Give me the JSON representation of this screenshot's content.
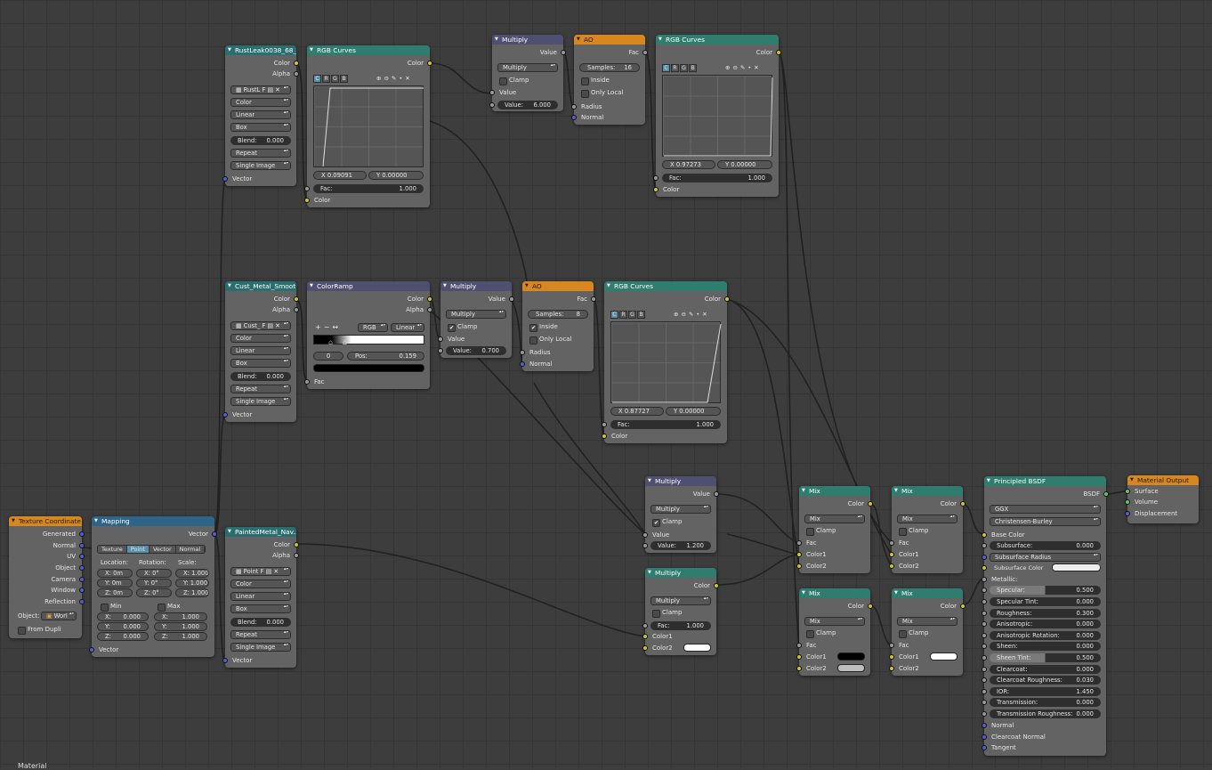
{
  "texcoord": {
    "title": "Texture Coordinate",
    "outputs": [
      "Generated",
      "Normal",
      "UV",
      "Object",
      "Camera",
      "Window",
      "Reflection"
    ],
    "object_label": "Object:",
    "object_value": "Worl",
    "from_dupli": "From Dupli"
  },
  "mapping": {
    "title": "Mapping",
    "out": "Vector",
    "tabs": [
      "Texture",
      "Point",
      "Vector",
      "Normal"
    ],
    "loc_label": "Location:",
    "rot_label": "Rotation:",
    "scale_label": "Scale:",
    "loc": [
      "X:  0m",
      "Y:  0m",
      "Z:  0m"
    ],
    "rot": [
      "X:  0°",
      "Y:  0°",
      "Z:  0°"
    ],
    "scale": [
      "X: 1.000",
      "Y: 1.000",
      "Z: 1.000"
    ],
    "min": "Min",
    "max": "Max",
    "minv": [
      [
        "X:",
        "0.000"
      ],
      [
        "Y:",
        "0.000"
      ],
      [
        "Z:",
        "0.000"
      ]
    ],
    "maxv": [
      [
        "X:",
        "1.000"
      ],
      [
        "Y:",
        "1.000"
      ],
      [
        "Z:",
        "1.000"
      ]
    ],
    "in": "Vector"
  },
  "img1": {
    "title": "RustLeak0038_68_",
    "img": "RustL",
    "f": "F",
    "out": [
      "Color",
      "Alpha"
    ],
    "dd": [
      "Color",
      "Linear",
      "Box"
    ],
    "blend_l": "Blend:",
    "blend": "0.000",
    "dd2": [
      "Repeat",
      "Single Image"
    ],
    "in": "Vector"
  },
  "img2": {
    "title": "Cust_Metal_Smoot...",
    "img": "Cust_",
    "f": "F",
    "out": [
      "Color",
      "Alpha"
    ],
    "dd": [
      "Color",
      "Linear",
      "Box"
    ],
    "blend_l": "Blend:",
    "blend": "0.000",
    "dd2": [
      "Repeat",
      "Single Image"
    ],
    "in": "Vector"
  },
  "img3": {
    "title": "PaintedMetal_Nav...",
    "img": "Point",
    "f": "F",
    "out": [
      "Color",
      "Alpha"
    ],
    "dd": [
      "Color",
      "Linear",
      "Box"
    ],
    "blend_l": "Blend:",
    "blend": "0.000",
    "dd2": [
      "Repeat",
      "Single Image"
    ],
    "in": "Vector"
  },
  "curves1": {
    "title": "RGB Curves",
    "out": "Color",
    "ch": [
      "C",
      "R",
      "G",
      "B"
    ],
    "x": "X 0.09091",
    "y": "Y 0.00000",
    "fac_l": "Fac:",
    "fac": "1.000",
    "in": "Color"
  },
  "curves2": {
    "title": "RGB Curves",
    "out": "Color",
    "ch": [
      "C",
      "R",
      "G",
      "B"
    ],
    "x": "X 0.97273",
    "y": "Y 0.00000",
    "fac_l": "Fac:",
    "fac": "1.000",
    "in": "Color"
  },
  "curves3": {
    "title": "RGB Curves",
    "out": "Color",
    "ch": [
      "C",
      "R",
      "G",
      "B"
    ],
    "x": "X 0.87727",
    "y": "Y 0.00000",
    "fac_l": "Fac:",
    "fac": "1.000",
    "in": "Color"
  },
  "mult1": {
    "title": "Multiply",
    "out": "Value",
    "op": "Multiply",
    "clamp": "Clamp",
    "in": "Value",
    "val_l": "Value:",
    "val": "6.000"
  },
  "mult2": {
    "title": "Multiply",
    "out": "Value",
    "op": "Multiply",
    "clamp": "Clamp",
    "in": "Value",
    "val_l": "Value:",
    "val": "0.700"
  },
  "mult3": {
    "title": "Multiply",
    "out": "Value",
    "op": "Multiply",
    "clamp": "Clamp",
    "in": "Value",
    "val_l": "Value:",
    "val": "1.200"
  },
  "mult4": {
    "title": "Multiply",
    "out": "Color",
    "op": "Multiply",
    "clamp": "Clamp",
    "fac_l": "Fac:",
    "fac": "1.000",
    "in": [
      "Color1",
      "Color2"
    ]
  },
  "ao1": {
    "title": "AO",
    "out": "Fac",
    "samples_l": "Samples:",
    "samples": "16",
    "inside": "Inside",
    "only_local": "Only Local",
    "in": [
      "Radius",
      "Normal"
    ]
  },
  "ao2": {
    "title": "AO",
    "out": "Fac",
    "samples_l": "Samples:",
    "samples": "8",
    "inside": "Inside",
    "only_local": "Only Local",
    "in": [
      "Radius",
      "Normal"
    ]
  },
  "ramp": {
    "title": "ColorRamp",
    "out": [
      "Color",
      "Alpha"
    ],
    "mode": "RGB",
    "interp": "Linear",
    "idx": "0",
    "pos_l": "Pos:",
    "pos": "0.159",
    "in": "Fac",
    "plus": "+",
    "minus": "−",
    "flip": "↔"
  },
  "mix": {
    "title": "Mix",
    "out": "Color",
    "op": "Mix",
    "clamp": "Clamp",
    "in": [
      "Fac",
      "Color1",
      "Color2"
    ]
  },
  "bsdf": {
    "title": "Principled BSDF",
    "out": "BSDF",
    "dist": "GGX",
    "sss": "Christensen-Burley",
    "base": "Base Color",
    "rows": [
      [
        "Subsurface:",
        "0.000"
      ],
      [
        "Subsurface Radius",
        ""
      ],
      [
        "Subsurface Color",
        ""
      ],
      [
        "Metallic:",
        ""
      ],
      [
        "Specular:",
        "0.500"
      ],
      [
        "Specular Tint:",
        "0.000"
      ],
      [
        "Roughness:",
        "0.300"
      ],
      [
        "Anisotropic:",
        "0.000"
      ],
      [
        "Anisotropic Rotation:",
        "0.000"
      ],
      [
        "Sheen:",
        "0.000"
      ],
      [
        "Sheen Tint:",
        "0.500"
      ],
      [
        "Clearcoat:",
        "0.000"
      ],
      [
        "Clearcoat Roughness:",
        "0.030"
      ],
      [
        "IOR:",
        "1.450"
      ],
      [
        "Transmission:",
        "0.000"
      ],
      [
        "Transmission Roughness:",
        "0.000"
      ]
    ],
    "tail": [
      "Normal",
      "Clearcoat Normal",
      "Tangent"
    ]
  },
  "output": {
    "title": "Material Output",
    "in": [
      "Surface",
      "Volume",
      "Displacement"
    ]
  },
  "footer": "Material"
}
